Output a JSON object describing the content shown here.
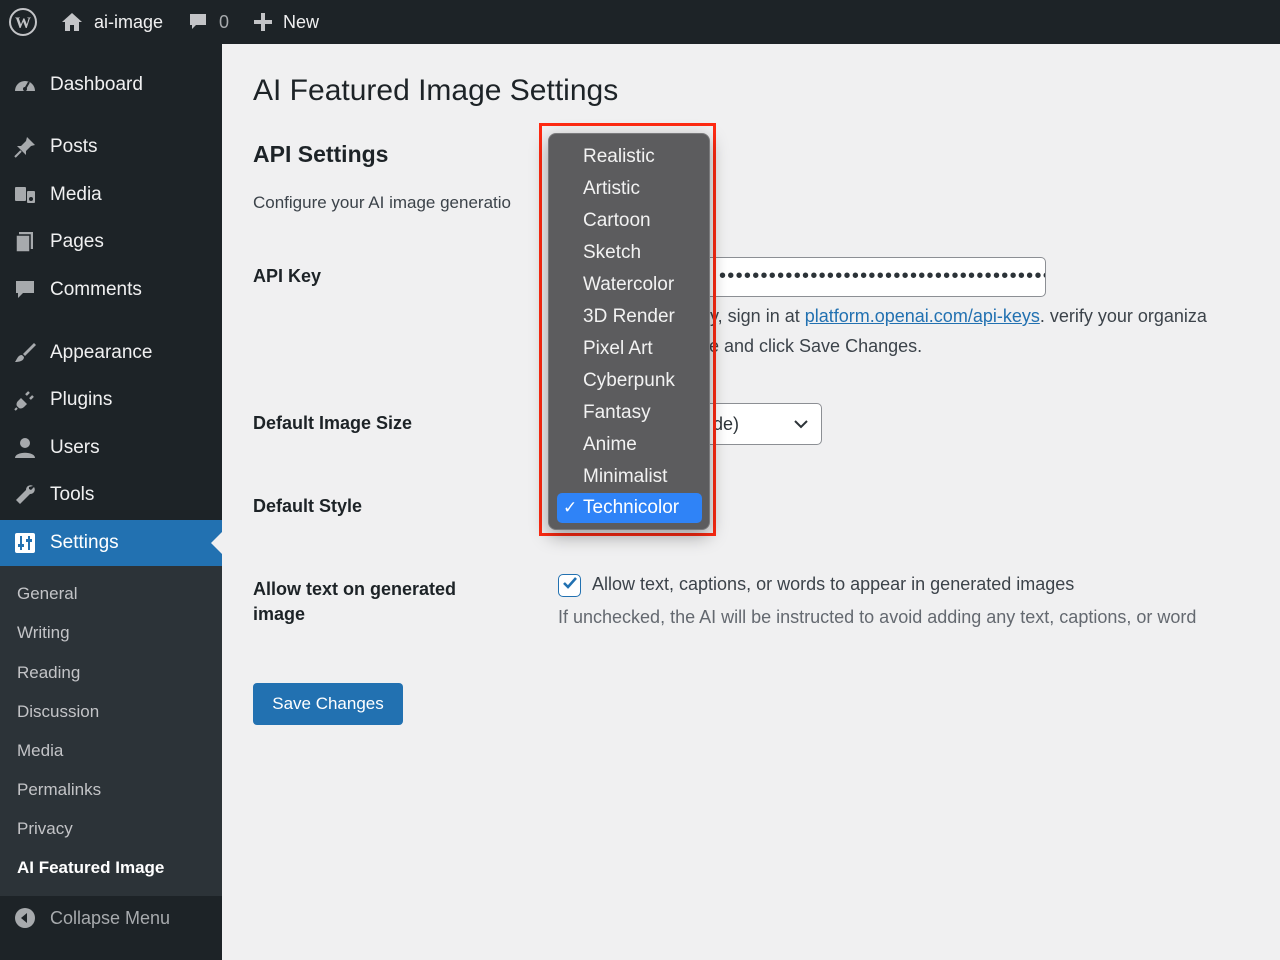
{
  "adminbar": {
    "site_name": "ai-image",
    "comments_count": "0",
    "new_label": "New"
  },
  "sidebar": {
    "items": [
      {
        "label": "Dashboard",
        "icon": "dashboard-icon"
      },
      {
        "label": "Posts",
        "icon": "pin-icon"
      },
      {
        "label": "Media",
        "icon": "media-icon"
      },
      {
        "label": "Pages",
        "icon": "pages-icon"
      },
      {
        "label": "Comments",
        "icon": "comment-icon"
      },
      {
        "label": "Appearance",
        "icon": "brush-icon"
      },
      {
        "label": "Plugins",
        "icon": "plug-icon"
      },
      {
        "label": "Users",
        "icon": "user-icon"
      },
      {
        "label": "Tools",
        "icon": "wrench-icon"
      },
      {
        "label": "Settings",
        "icon": "settings-icon"
      }
    ],
    "submenu": [
      "General",
      "Writing",
      "Reading",
      "Discussion",
      "Media",
      "Permalinks",
      "Privacy",
      "AI Featured Image"
    ],
    "collapse_label": "Collapse Menu"
  },
  "main": {
    "title": "AI Featured Image Settings",
    "section_title": "API Settings",
    "section_desc": "Configure your AI image generatio",
    "api_key": {
      "label": "API Key",
      "value": "••••••••••••••••••••••••••••••••••••••••",
      "help_prefix": "ey, sign in at ",
      "help_link": "platform.openai.com/api-keys",
      "help_suffix": ". verify your organiza",
      "help_line2": "ve and click Save Changes."
    },
    "image_size": {
      "label": "Default Image Size",
      "value": "de)"
    },
    "style": {
      "label": "Default Style",
      "options": [
        "Realistic",
        "Artistic",
        "Cartoon",
        "Sketch",
        "Watercolor",
        "3D Render",
        "Pixel Art",
        "Cyberpunk",
        "Fantasy",
        "Anime",
        "Minimalist",
        "Technicolor"
      ],
      "selected": "Technicolor",
      "check_glyph": "✓"
    },
    "allow_text": {
      "label": "Allow text on generated image",
      "checked": true,
      "checkbox_label": "Allow text, captions, or words to appear in generated images",
      "description": "If unchecked, the AI will be instructed to avoid adding any text, captions, or word"
    },
    "save_label": "Save Changes"
  },
  "colors": {
    "accent": "#2271b1",
    "highlight": "#ff2a12",
    "selected_option": "#2f83f7"
  }
}
